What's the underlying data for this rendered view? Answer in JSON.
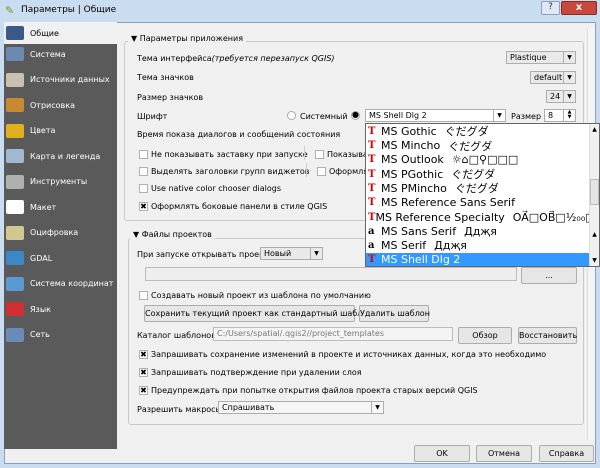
{
  "window": {
    "title": "Параметры | Общие",
    "help": "?",
    "close": "x"
  },
  "sidebar": {
    "items": [
      {
        "label": "Общие",
        "icon": "tools-icon",
        "color": "#3a5a8a"
      },
      {
        "label": "Система",
        "icon": "gear-icon",
        "color": "#6a8ab0"
      },
      {
        "label": "Источники данных",
        "icon": "table-icon",
        "color": "#c8c0b0"
      },
      {
        "label": "Отрисовка",
        "icon": "brush-icon",
        "color": "#c88a30"
      },
      {
        "label": "Цвета",
        "icon": "palette-icon",
        "color": "#e0b020"
      },
      {
        "label": "Карта и легенда",
        "icon": "map-icon",
        "color": "#a0b8d0"
      },
      {
        "label": "Инструменты",
        "icon": "tools-map-icon",
        "color": "#b0b0b0"
      },
      {
        "label": "Макет",
        "icon": "page-icon",
        "color": "#ffffff"
      },
      {
        "label": "Оцифровка",
        "icon": "pencil-icon",
        "color": "#d0c890"
      },
      {
        "label": "GDAL",
        "icon": "globe-icon",
        "color": "#3a88c8"
      },
      {
        "label": "Система координат",
        "icon": "globe-grid-icon",
        "color": "#5a9ad0"
      },
      {
        "label": "Язык",
        "icon": "flags-icon",
        "color": "#d03030"
      },
      {
        "label": "Сеть",
        "icon": "network-icon",
        "color": "#6a8ab8"
      }
    ]
  },
  "app": {
    "group_title": "Параметры приложения",
    "theme_label": "Тема интерфейса",
    "theme_note": "(требуется перезапуск QGIS)",
    "theme_value": "Plastique",
    "icon_theme_label": "Тема значков",
    "icon_theme_value": "default",
    "icon_size_label": "Размер значков",
    "icon_size_value": "24",
    "font_label": "Шрифт",
    "font_system": "Системный",
    "font_value": "MS Shell Dlg 2",
    "size_label": "Размер",
    "size_value": "8",
    "timeout_label": "Время показа диалогов и сообщений состояния",
    "checks": [
      {
        "label": "Не показывать заставку при запуске",
        "checked": false
      },
      {
        "label": "Выделять заголовки групп виджетов",
        "checked": false
      },
      {
        "label": "Use native color chooser dialogs",
        "checked": false
      },
      {
        "label": "Оформлять боковые панели в стиле QGIS",
        "checked": true
      }
    ],
    "checks_right": [
      {
        "label": "Показыва",
        "checked": false
      },
      {
        "label": "Оформлят",
        "checked": false
      }
    ]
  },
  "font_popup": {
    "items": [
      {
        "name": "MS Gothic",
        "sample": "ぐだグダ",
        "type": "truetype"
      },
      {
        "name": "MS Mincho",
        "sample": "ぐだグダ",
        "type": "truetype"
      },
      {
        "name": "MS Outlook",
        "sample": "☼⌂□⚲□□□",
        "type": "truetype"
      },
      {
        "name": "MS PGothic",
        "sample": "ぐだグダ",
        "type": "truetype"
      },
      {
        "name": "MS PMincho",
        "sample": "ぐだグダ",
        "type": "truetype"
      },
      {
        "name": "MS Reference Sans Serif",
        "sample": "",
        "type": "truetype"
      },
      {
        "name": "MS Reference Specialty",
        "sample": "OA⃗□OB⃗□¹⁄₂₀₀□",
        "type": "truetype"
      },
      {
        "name": "MS Sans Serif",
        "sample": "Ддҗя",
        "type": "bitmap"
      },
      {
        "name": "MS Serif",
        "sample": "Ддҗя",
        "type": "bitmap"
      },
      {
        "name": "MS Shell Dlg 2",
        "sample": "",
        "type": "truetype",
        "selected": true
      }
    ]
  },
  "projects": {
    "group_title": "Файлы проектов",
    "open_label": "При запуске открывать проект",
    "open_value": "Новый",
    "path_value": "",
    "browse_dots": "...",
    "create_from_template": "Создавать новый проект из шаблона по умолчанию",
    "save_template": "Сохранить текущий проект как стандартный шаблон",
    "delete_template": "Удалить шаблон",
    "template_dir_label": "Каталог шаблонов",
    "template_dir_value": "C:/Users/spatial/.qgis2//project_templates",
    "browse": "Обзор",
    "restore": "Восстановить",
    "checks": [
      {
        "label": "Запрашивать сохранение изменений в проекте и источниках данных, когда это необходимо",
        "checked": true
      },
      {
        "label": "Запрашивать подтверждение при удалении слоя",
        "checked": true
      },
      {
        "label": "Предупреждать при попытке открытия файлов проекта старых версий QGIS",
        "checked": true
      }
    ],
    "macros_label": "Разрешить макросы",
    "macros_value": "Спрашивать"
  },
  "buttons": {
    "ok": "OK",
    "cancel": "Отмена",
    "help": "Справка"
  }
}
